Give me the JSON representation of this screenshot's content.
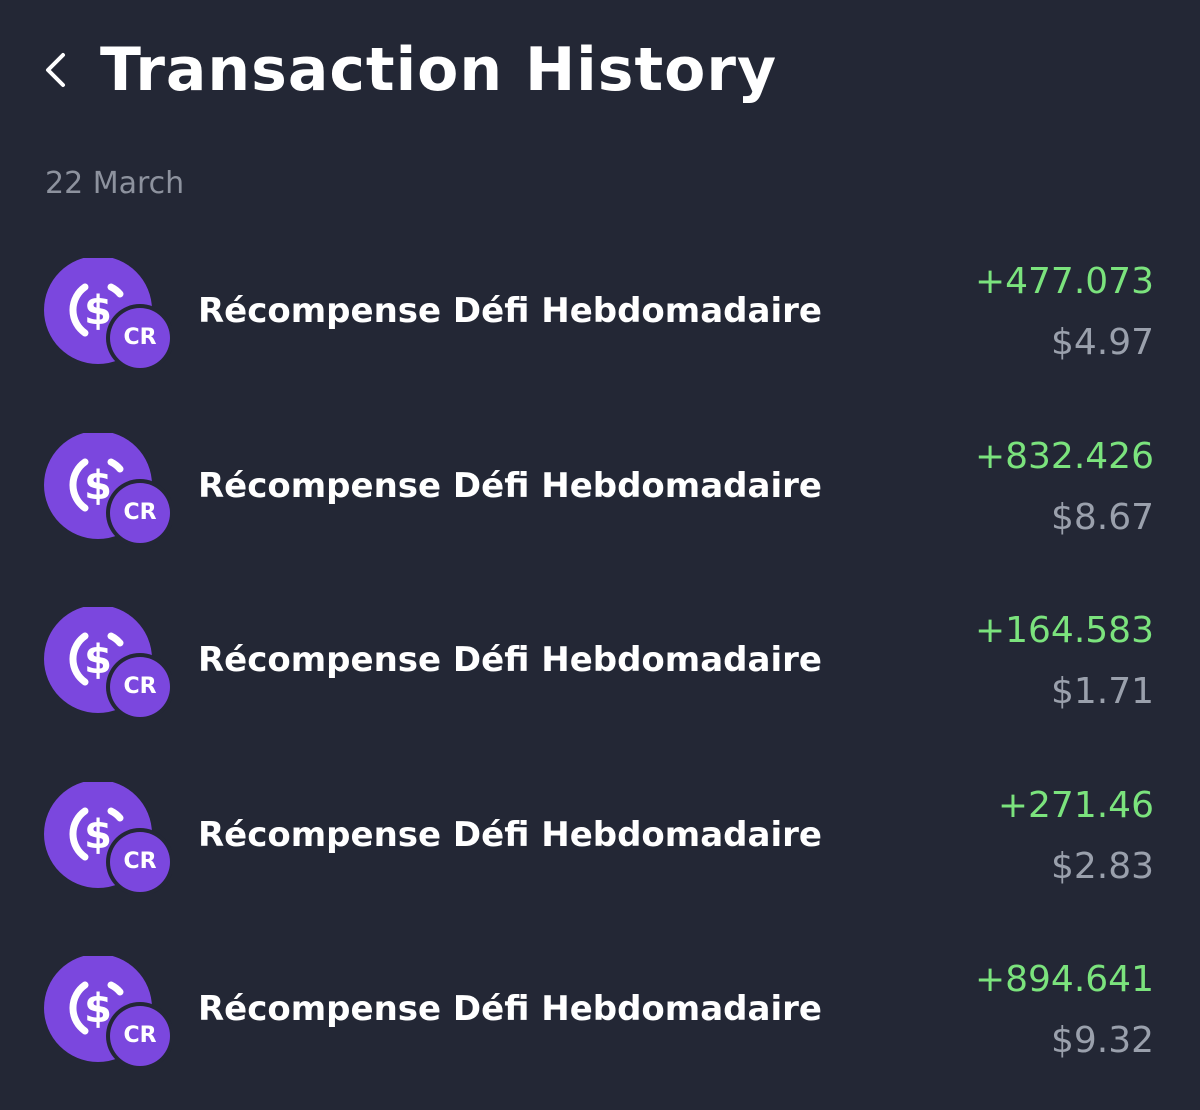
{
  "header": {
    "title": "Transaction History",
    "back_icon": "chevron-left-icon"
  },
  "sections": [
    {
      "date": "22 March",
      "transactions": [
        {
          "icon": "usdc-coin-icon",
          "badge": "CR",
          "title": "Récompense Défi Hebdomadaire",
          "amount": "+477.073",
          "fiat": "$4.97"
        },
        {
          "icon": "usdc-coin-icon",
          "badge": "CR",
          "title": "Récompense Défi Hebdomadaire",
          "amount": "+832.426",
          "fiat": "$8.67"
        },
        {
          "icon": "usdc-coin-icon",
          "badge": "CR",
          "title": "Récompense Défi Hebdomadaire",
          "amount": "+164.583",
          "fiat": "$1.71"
        },
        {
          "icon": "usdc-coin-icon",
          "badge": "CR",
          "title": "Récompense Défi Hebdomadaire",
          "amount": "+271.46",
          "fiat": "$2.83"
        },
        {
          "icon": "usdc-coin-icon",
          "badge": "CR",
          "title": "Récompense Défi Hebdomadaire",
          "amount": "+894.641",
          "fiat": "$9.32"
        }
      ]
    }
  ],
  "colors": {
    "background": "#232735",
    "coin_purple": "#7b47de",
    "badge_purple": "#7b47de",
    "positive_green": "#7be37d",
    "muted_text": "#8d929e",
    "fiat_text": "#9aa0ac",
    "title_text": "#ffffff"
  }
}
